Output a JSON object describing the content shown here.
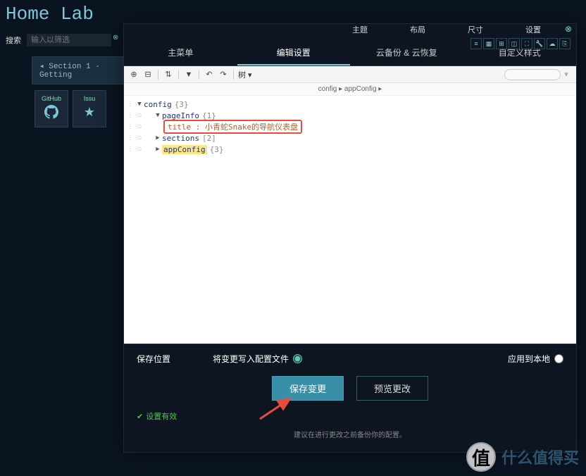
{
  "header": {
    "title": "Home Lab",
    "search_label": "搜索",
    "search_placeholder": "输入以筛选"
  },
  "top_menus": {
    "theme": "主题",
    "layout": "布局",
    "size": "尺寸",
    "settings": "设置"
  },
  "bg_section": {
    "title": "◂ Section 1 - Getting",
    "items": [
      {
        "label": "GitHub",
        "icon": "github"
      },
      {
        "label": "Issu",
        "icon": "bug"
      }
    ]
  },
  "modal": {
    "tabs": {
      "main": "主菜单",
      "edit": "编辑设置",
      "cloud": "云备份 & 云恢复",
      "style": "自定义样式"
    },
    "toolbar": {
      "view_mode": "树"
    },
    "breadcrumb": "config ▸ appConfig ▸",
    "tree": {
      "root": {
        "key": "config",
        "count": "{3}"
      },
      "pageInfo": {
        "key": "pageInfo",
        "count": "{1}"
      },
      "title_line": "title : 小青蛇Snake的导航仪表盘",
      "sections": {
        "key": "sections",
        "count": "[2]"
      },
      "appConfig": {
        "key": "appConfig",
        "count": "{3}"
      }
    },
    "footer": {
      "save_location": "保存位置",
      "write_config": "将变更写入配置文件",
      "apply_local": "应用到本地",
      "save_btn": "保存变更",
      "preview_btn": "预览更改",
      "valid": "设置有效",
      "hint": "建议在进行更改之前备份你的配置。"
    }
  },
  "watermark": {
    "circle": "值",
    "text": "什么值得买"
  }
}
